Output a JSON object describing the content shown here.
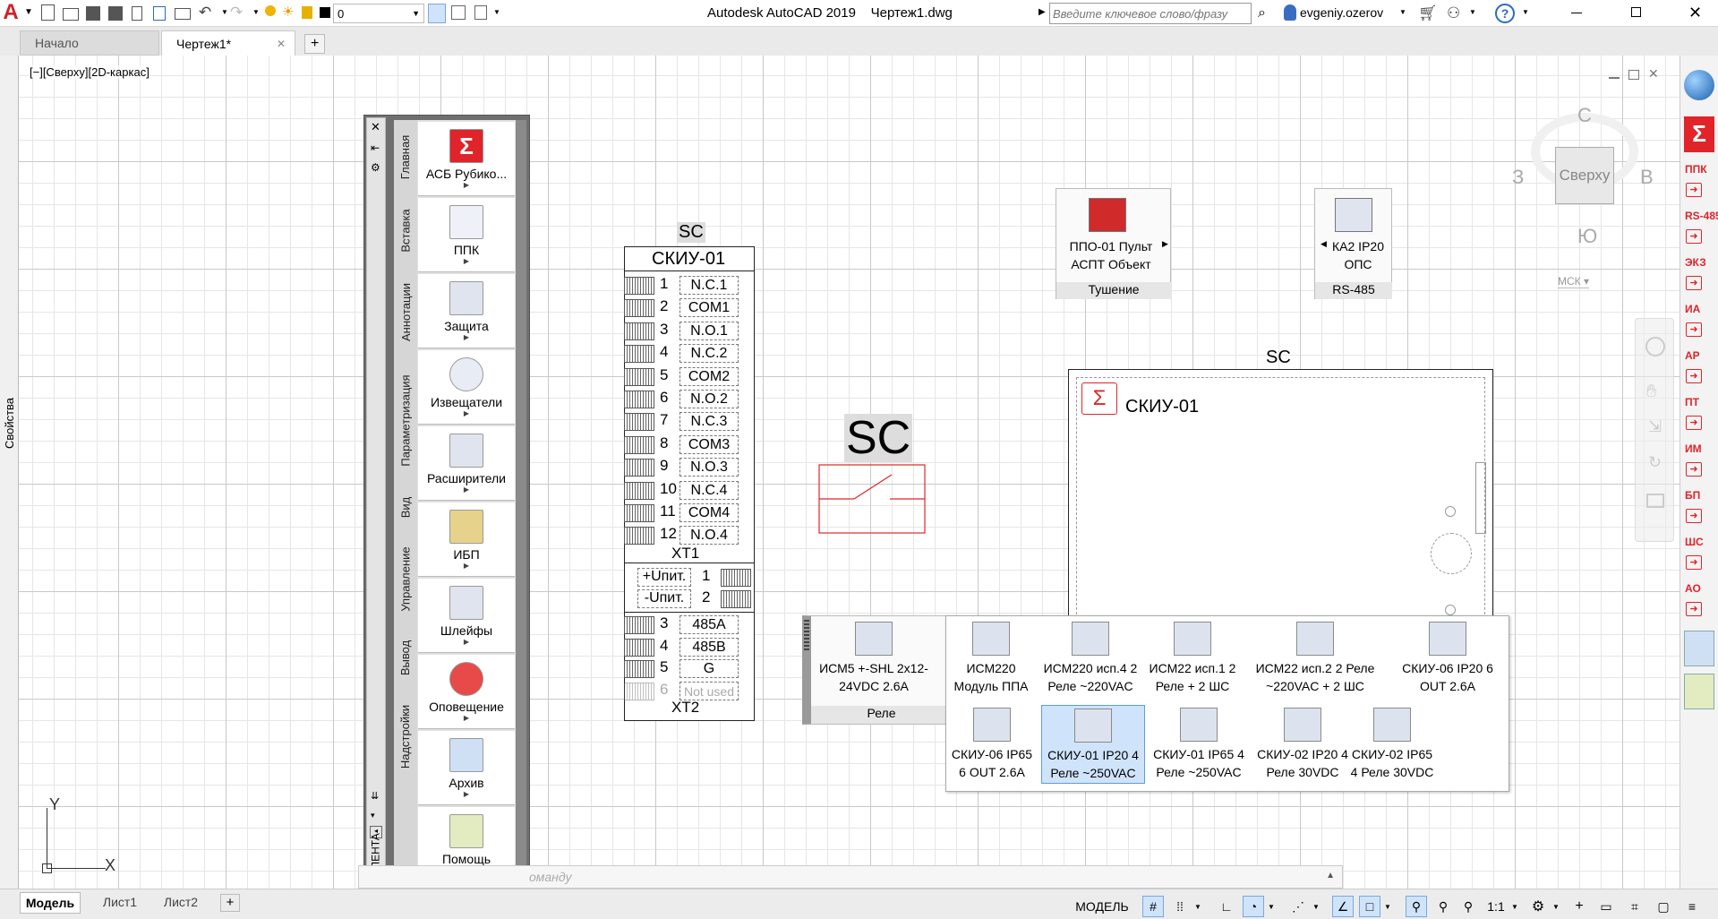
{
  "titlebar": {
    "app_title": "Autodesk AutoCAD 2019    Чертеж1.dwg",
    "layer_name": "0",
    "search_placeholder": "Введите ключевое слово/фразу",
    "user_name": "evgeniy.ozerov",
    "help_label": "?"
  },
  "doc_tabs": {
    "start": "Начало",
    "drawing": "Чертеж1*",
    "close": "✕",
    "new": "+"
  },
  "viewport": {
    "label": "[−][Сверху][2D-каркас]"
  },
  "properties_strip": "Свойства",
  "viewcube": {
    "north": "С",
    "south": "Ю",
    "west": "З",
    "east": "В",
    "face": "Сверху",
    "ucs": "МСК"
  },
  "palette": {
    "ribbon_label": "ЛЕНТА",
    "vertical_tabs": [
      "Главная",
      "Вставка",
      "Аннотации",
      "Параметризация",
      "Вид",
      "Управление",
      "Вывод",
      "Надстройки"
    ],
    "buttons": [
      {
        "label": "АСБ Рубико...",
        "icon": "sigma-logo-icon"
      },
      {
        "label": "ППК",
        "icon": "control-panel-icon"
      },
      {
        "label": "Защита",
        "icon": "protection-icon"
      },
      {
        "label": "Извещатели",
        "icon": "detector-icon"
      },
      {
        "label": "Расширители",
        "icon": "expander-icon"
      },
      {
        "label": "ИБП",
        "icon": "ups-icon"
      },
      {
        "label": "Шлейфы",
        "icon": "loop-icon"
      },
      {
        "label": "Оповещение",
        "icon": "siren-icon"
      },
      {
        "label": "Архив",
        "icon": "archive-icon"
      },
      {
        "label": "Помощь",
        "icon": "help-icon"
      }
    ]
  },
  "terminal_block": {
    "tag": "SC",
    "title": "СКИУ-01",
    "rows_top": [
      {
        "n": "1",
        "label": "N.C.1"
      },
      {
        "n": "2",
        "label": "COM1"
      },
      {
        "n": "3",
        "label": "N.O.1"
      },
      {
        "n": "4",
        "label": "N.C.2"
      },
      {
        "n": "5",
        "label": "COM2"
      },
      {
        "n": "6",
        "label": "N.O.2"
      },
      {
        "n": "7",
        "label": "N.C.3"
      },
      {
        "n": "8",
        "label": "COM3"
      },
      {
        "n": "9",
        "label": "N.O.3"
      },
      {
        "n": "10",
        "label": "N.C.4"
      },
      {
        "n": "11",
        "label": "COM4"
      },
      {
        "n": "12",
        "label": "N.O.4"
      }
    ],
    "xt1": "XT1",
    "power_rows": [
      {
        "label": "+Uпит.",
        "n": "1"
      },
      {
        "label": "-Uпит.",
        "n": "2"
      }
    ],
    "rows_bottom": [
      {
        "n": "3",
        "label": "485A"
      },
      {
        "n": "4",
        "label": "485B"
      },
      {
        "n": "5",
        "label": "G"
      },
      {
        "n": "6",
        "label": "Not used"
      }
    ],
    "xt2": "XT2"
  },
  "relay_symbol": {
    "tag": "SC"
  },
  "device_view": {
    "tag": "SC",
    "title": "СКИУ-01"
  },
  "mini_cards": [
    {
      "label": "ППО-01 Пульт АСПТ Объект",
      "footer": "Тушение"
    },
    {
      "label": "КА2 IP20 ОПС",
      "footer": "RS-485"
    }
  ],
  "relay_popup": {
    "left_item": "ИСМ5 +-SHL 2х12-24VDC 2.6A",
    "left_footer": "Реле",
    "items_row1": [
      {
        "label": "ИСМ220 Модуль ППА",
        "icon": "ism220-icon"
      },
      {
        "label": "ИСМ220 исп.4 2 Реле ~220VAC",
        "icon": "ism220-4-icon"
      },
      {
        "label": "ИСМ22 исп.1 2 Реле + 2 ШС",
        "icon": "ism22-1-icon"
      },
      {
        "label": "ИСМ22 исп.2 2 Реле ~220VAC + 2 ШС",
        "icon": "ism22-2-icon"
      },
      {
        "label": "СКИУ-06 IP20 6 OUT 2.6A",
        "icon": "skiu06-icon"
      }
    ],
    "items_row2": [
      {
        "label": "СКИУ-06 IP65 6 OUT 2.6A",
        "icon": "skiu06-ip65-icon"
      },
      {
        "label": "СКИУ-01 IP20 4 Реле ~250VAC",
        "icon": "skiu01-icon",
        "selected": true
      },
      {
        "label": "СКИУ-01 IP65 4 Реле ~250VAC",
        "icon": "skiu01-ip65-icon"
      },
      {
        "label": "СКИУ-02 IP20 4 Реле 30VDC",
        "icon": "skiu02-icon"
      },
      {
        "label": "СКИУ-02 IP65 4 Реле 30VDC",
        "icon": "skiu02-ip65-icon"
      }
    ]
  },
  "command_line": {
    "placeholder": "оманду"
  },
  "layout_tabs": [
    "Модель",
    "Лист1",
    "Лист2"
  ],
  "statusbar": {
    "model": "МОДЕЛЬ",
    "scale": "1:1"
  },
  "right_toolbar": [
    {
      "label": "ППК"
    },
    {
      "label": "RS-485"
    },
    {
      "label": "ЭКЗ"
    },
    {
      "label": "ИА"
    },
    {
      "label": "АР"
    },
    {
      "label": "ПТ"
    },
    {
      "label": "ИМ"
    },
    {
      "label": "БП"
    },
    {
      "label": "ШС"
    },
    {
      "label": "АО"
    }
  ],
  "colors": {
    "accent_red": "#e0242a",
    "selected_bg": "#cfe4fb",
    "palette_bg": "#6f6f6f"
  }
}
